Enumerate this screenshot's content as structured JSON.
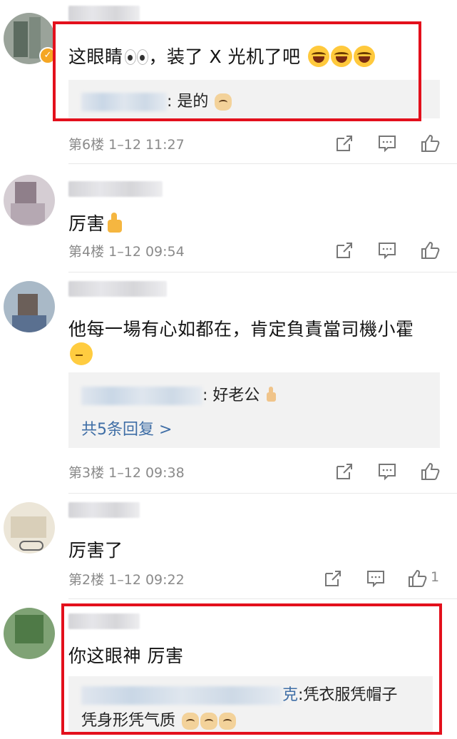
{
  "comments": [
    {
      "text": "这眼睛",
      "text2": "，装了 X 光机了吧",
      "reply_text": ": 是的",
      "floor": "第6楼",
      "time": "1–12 11:27"
    },
    {
      "text": "厉害",
      "floor": "第4楼",
      "time": "1–12 09:54"
    },
    {
      "text": "他每一場有心如都在，肯定負責當司機小霍",
      "reply_text": ": 好老公",
      "more_replies": "共5条回复 >",
      "floor": "第3楼",
      "time": "1–12 09:38"
    },
    {
      "text": "厉害了",
      "floor": "第2楼",
      "time": "1–12 09:22",
      "likes": "1"
    },
    {
      "text": "你这眼神 厉害",
      "reply_suffix": "克",
      "reply_text": ":凭衣服凭帽子",
      "reply_text2": "凭身形凭气质"
    }
  ],
  "icons": {
    "share": "share-icon",
    "comment": "comment-icon",
    "like": "like-icon",
    "verified": "verified-badge-icon"
  },
  "colors": {
    "highlight_border": "#e3101c",
    "link_blue": "#3f6ea6",
    "meta_gray": "#8a8a8a",
    "reply_bg": "#f2f2f2"
  }
}
